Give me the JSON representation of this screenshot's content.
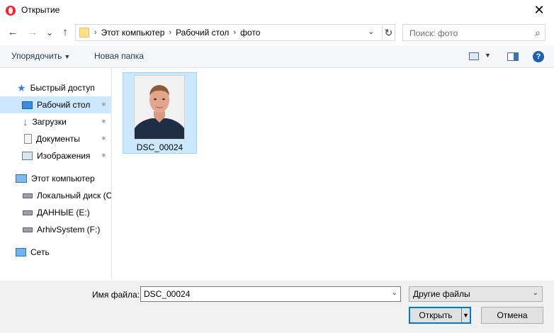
{
  "window": {
    "title": "Открытие",
    "close_glyph": "✕"
  },
  "nav": {
    "back_glyph": "←",
    "forward_glyph": "→",
    "recent_glyph": "⌄",
    "up_glyph": "↑",
    "breadcrumbs": [
      "Этот компьютер",
      "Рабочий стол",
      "фото"
    ],
    "refresh_glyph": "↻"
  },
  "search": {
    "placeholder": "Поиск: фото"
  },
  "toolbar": {
    "organize_label": "Упорядочить",
    "new_folder_label": "Новая папка",
    "help_glyph": "?"
  },
  "sidebar": {
    "quick_access": "Быстрый доступ",
    "items": [
      {
        "label": "Рабочий стол",
        "pinned": true,
        "selected": true
      },
      {
        "label": "Загрузки",
        "pinned": true
      },
      {
        "label": "Документы",
        "pinned": true
      },
      {
        "label": "Изображения",
        "pinned": true
      }
    ],
    "this_pc": "Этот компьютер",
    "drives": [
      "Локальный диск (C",
      "ДАННЫЕ (E:)",
      "ArhivSystem (F:)"
    ],
    "network": "Сеть"
  },
  "files": [
    {
      "name": "DSC_00024",
      "selected": true
    }
  ],
  "bottom": {
    "filename_label": "Имя файла:",
    "filename_value": "DSC_00024",
    "filetype_value": "Другие файлы",
    "open_label": "Открыть",
    "cancel_label": "Отмена"
  },
  "colors": {
    "selection": "#cce8ff",
    "accent": "#0078d7"
  }
}
